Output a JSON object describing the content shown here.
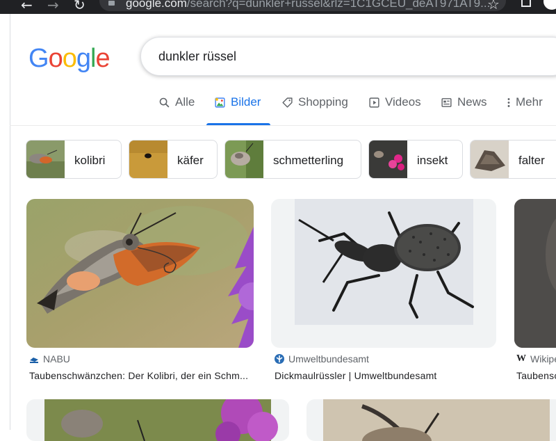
{
  "browser": {
    "url_host": "google.com",
    "url_rest": "/search?q=dunkler+rüssel&rlz=1C1GCEU_deAT971AT9..."
  },
  "logo": {
    "letters": [
      "G",
      "o",
      "o",
      "g",
      "l",
      "e"
    ],
    "colors": [
      "#4285F4",
      "#EA4335",
      "#FBBC05",
      "#4285F4",
      "#34A853",
      "#EA4335"
    ]
  },
  "search": {
    "query": "dunkler rüssel"
  },
  "tabs": [
    {
      "label": "Alle",
      "icon": "search-icon"
    },
    {
      "label": "Bilder",
      "icon": "image-icon",
      "active": true
    },
    {
      "label": "Shopping",
      "icon": "tag-icon"
    },
    {
      "label": "Videos",
      "icon": "play-icon"
    },
    {
      "label": "News",
      "icon": "news-icon"
    },
    {
      "label": "Mehr",
      "icon": "more-vert-icon"
    }
  ],
  "chips": [
    {
      "label": "kolibri"
    },
    {
      "label": "käfer"
    },
    {
      "label": "schmetterling"
    },
    {
      "label": "insekt"
    },
    {
      "label": "falter"
    }
  ],
  "results": [
    {
      "source": "NABU",
      "title": "Taubenschwänzchen: Der Kolibri, der ein Schm..."
    },
    {
      "source": "Umweltbundesamt",
      "title": "Dickmaulrüssler | Umweltbundesamt"
    },
    {
      "source": "Wikipe",
      "title": "Taubensc"
    }
  ],
  "colors": {
    "accent": "#1a73e8",
    "chrome": "#202124"
  }
}
